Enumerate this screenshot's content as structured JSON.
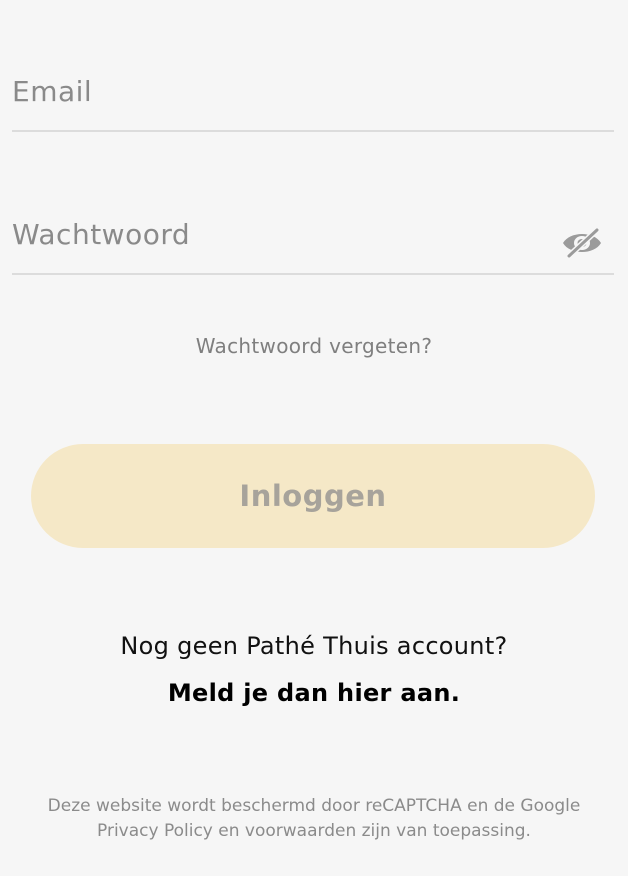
{
  "form": {
    "email": {
      "placeholder": "Email",
      "value": ""
    },
    "password": {
      "placeholder": "Wachtwoord",
      "value": ""
    },
    "visibility_icon": "eye-slash-icon",
    "forgot_label": "Wachtwoord vergeten?",
    "login_label": "Inloggen"
  },
  "signup": {
    "question": "Nog geen Pathé Thuis account?",
    "link_label": "Meld je dan hier aan."
  },
  "legal": {
    "line1": "Deze website wordt beschermd door reCAPTCHA en de Google",
    "line2": "Privacy Policy en voorwaarden zijn van toepassing."
  },
  "colors": {
    "background": "#f6f6f6",
    "button_bg": "#f5e8c7",
    "button_text": "#a7a39b",
    "muted_text": "#8a8a8a"
  }
}
